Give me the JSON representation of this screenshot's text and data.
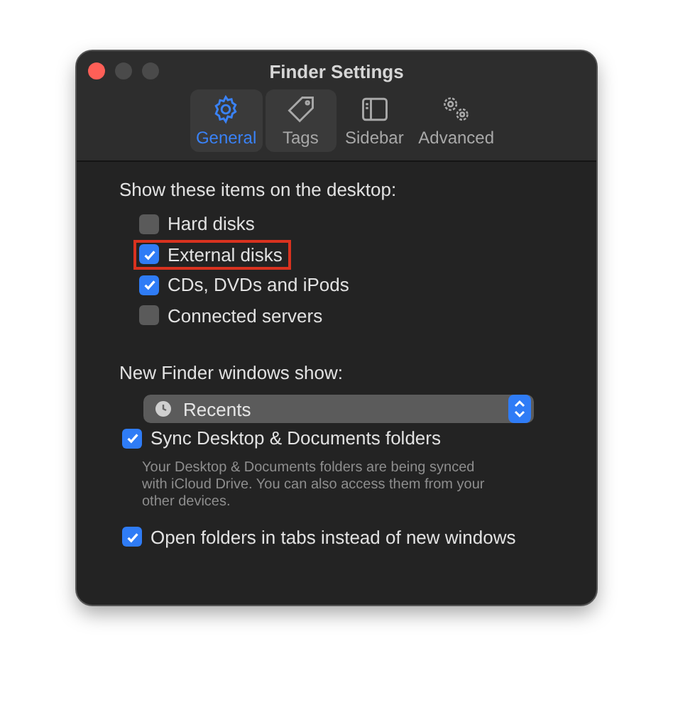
{
  "window": {
    "title": "Finder Settings"
  },
  "tabs": [
    {
      "label": "General",
      "selected": true,
      "hovered": false
    },
    {
      "label": "Tags",
      "selected": false,
      "hovered": true
    },
    {
      "label": "Sidebar",
      "selected": false,
      "hovered": false
    },
    {
      "label": "Advanced",
      "selected": false,
      "hovered": false
    }
  ],
  "desktop_section": {
    "label": "Show these items on the desktop:",
    "items": [
      {
        "label": "Hard disks",
        "checked": false,
        "highlighted": false
      },
      {
        "label": "External disks",
        "checked": true,
        "highlighted": true
      },
      {
        "label": "CDs, DVDs and iPods",
        "checked": true,
        "highlighted": false
      },
      {
        "label": "Connected servers",
        "checked": false,
        "highlighted": false
      }
    ]
  },
  "new_windows": {
    "label": "New Finder windows show:",
    "value": "Recents"
  },
  "options": [
    {
      "label": "Sync Desktop & Documents folders",
      "checked": true,
      "description": "Your Desktop & Documents folders are being synced with iCloud Drive. You can also access them from your other devices."
    },
    {
      "label": "Open folders in tabs instead of new windows",
      "checked": true
    }
  ]
}
